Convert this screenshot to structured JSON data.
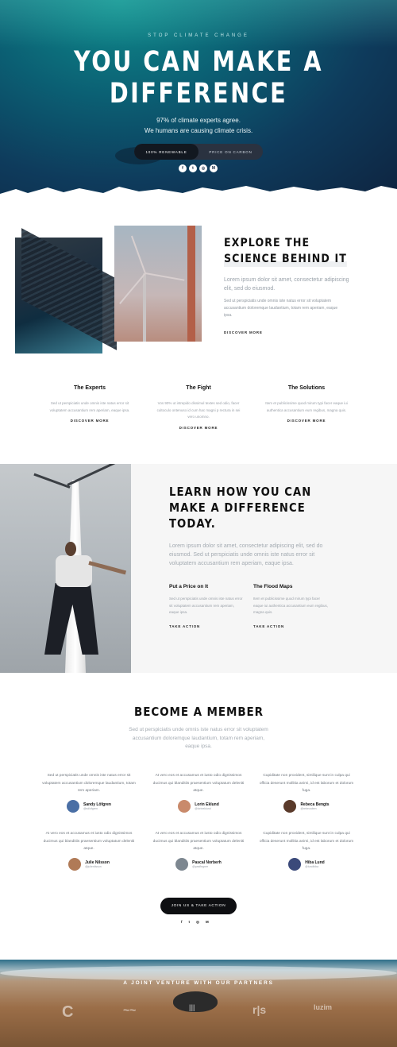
{
  "hero": {
    "kicker": "STOP CLIMATE CHANGE",
    "title_line1": "YOU CAN MAKE A",
    "title_line2": "DIFFERENCE",
    "sub_line1": "97% of climate experts agree.",
    "sub_line2": "We humans are causing climate crisis.",
    "toggle_left": "100% RENEWABLE",
    "toggle_right": "PRICE ON CARBON",
    "social_icons": [
      "facebook-icon",
      "twitter-icon",
      "instagram-icon",
      "medium-icon"
    ]
  },
  "explore": {
    "title_line1": "EXPLORE THE",
    "title_line2": "SCIENCE BEHIND IT",
    "lead": "Lorem ipsum dolor sit amet, consectetur adipiscing elit, sed do eiusmod.",
    "body": "Sed ut perspiciatis unde omnis iste natus error sit voluptatem accusantium doloremque laudantium, totam rem aperiam, eaque ipsa.",
    "link": "DISCOVER MORE"
  },
  "features": [
    {
      "title": "The Experts",
      "text": "Sed ut perspiciatis unde omnis iste natus error sit voluptatem accusantium rem aperiam, eaque ipsa.",
      "link": "DISCOVER MORE"
    },
    {
      "title": "The Fight",
      "text": "Vos 90% ut intrepido dissimul textes sed odio, facer cultoculo ontenuso id cum hac magni p rectura in sei vero unomno.",
      "link": "DISCOVER MORE"
    },
    {
      "title": "The Solutions",
      "text": "Item et publicissime quod mirum typi facer eaque iui authentica accusantium eum regibus, magna quis.",
      "link": "DISCOVER MORE"
    }
  ],
  "learn": {
    "title_line1": "LEARN HOW YOU CAN",
    "title_line2": "MAKE A DIFFERENCE",
    "title_line3": "TODAY.",
    "lead": "Lorem ipsum dolor sit amet, consectetur adipiscing elit, sed do eiusmod. Sed ut perspiciatis unde omnis iste natus error sit voluptatem accusantium rem aperiam, eaque ipsa.",
    "cols": [
      {
        "title": "Put a Price on It",
        "text": "Sed ut perspiciatis unde omnis iste natus error sit voluptatem accusantium rem aperiam, eaque ipsa.",
        "link": "TAKE ACTION"
      },
      {
        "title": "The Flood Maps",
        "text": "Item et publicissime quod mirum typi facer eaque iui authentica accusantium eum regibus, magna quis.",
        "link": "TAKE ACTION"
      }
    ]
  },
  "member": {
    "title": "BECOME A MEMBER",
    "lead": "Sed ut perspiciatis unde omnis iste natus error sit voluptatem accusantium doloremque laudantium, totam rem aperiam, eaque ipsa.",
    "testimonials": [
      {
        "quote": "Sed ut perspiciatis unde omnis iste natus error sit voluptatem accusantium doloremque laudantium, totam rem aperiam.",
        "name": "Sandy Löfgren",
        "handle": "@sdlofgren",
        "avatar_color": "#4a6fa5"
      },
      {
        "quote": "At vero eos et accusamus et iusto odio dignissimos ducimus qui blanditiis praesentium voluptatum deleniti atque.",
        "name": "Lorin Eklund",
        "handle": "@lorineklund",
        "avatar_color": "#c98a6b"
      },
      {
        "quote": "Cupiditate non provident, similique sunt in culpa qui officia deserunt mollitia animi, id est laborum et dolorum fuga.",
        "name": "Rebeca Bengts",
        "handle": "@rebecaben",
        "avatar_color": "#5a3a2a"
      },
      {
        "quote": "At vero eos et accusamus et iusto odio dignissimos ducimus qui blanditiis praesentium voluptatum deleniti atque.",
        "name": "Julie Nilsson",
        "handle": "@julienilsson",
        "avatar_color": "#b07a57"
      },
      {
        "quote": "At vero eos et accusamus et iusto odio dignissimos ducimus qui blanditiis praesentium voluptatum deleniti atque.",
        "name": "Pascal Norberh",
        "handle": "@pasflegner",
        "avatar_color": "#7d8790"
      },
      {
        "quote": "Cupiditate non provident, similique sunt in culpa qui officia deserunt mollitia animi, id est laborum et dolorum fuga.",
        "name": "Hiba Lund",
        "handle": "@lundhiba",
        "avatar_color": "#3b4a7a"
      }
    ],
    "button": "JOIN US & TAKE ACTION",
    "footer_social": [
      "f",
      "t",
      "◎",
      "M"
    ]
  },
  "partners": {
    "kicker": "A JOINT VENTURE WITH OUR PARTNERS",
    "logos": [
      "C",
      "~~",
      "|||",
      "r|s",
      "luzim"
    ]
  }
}
